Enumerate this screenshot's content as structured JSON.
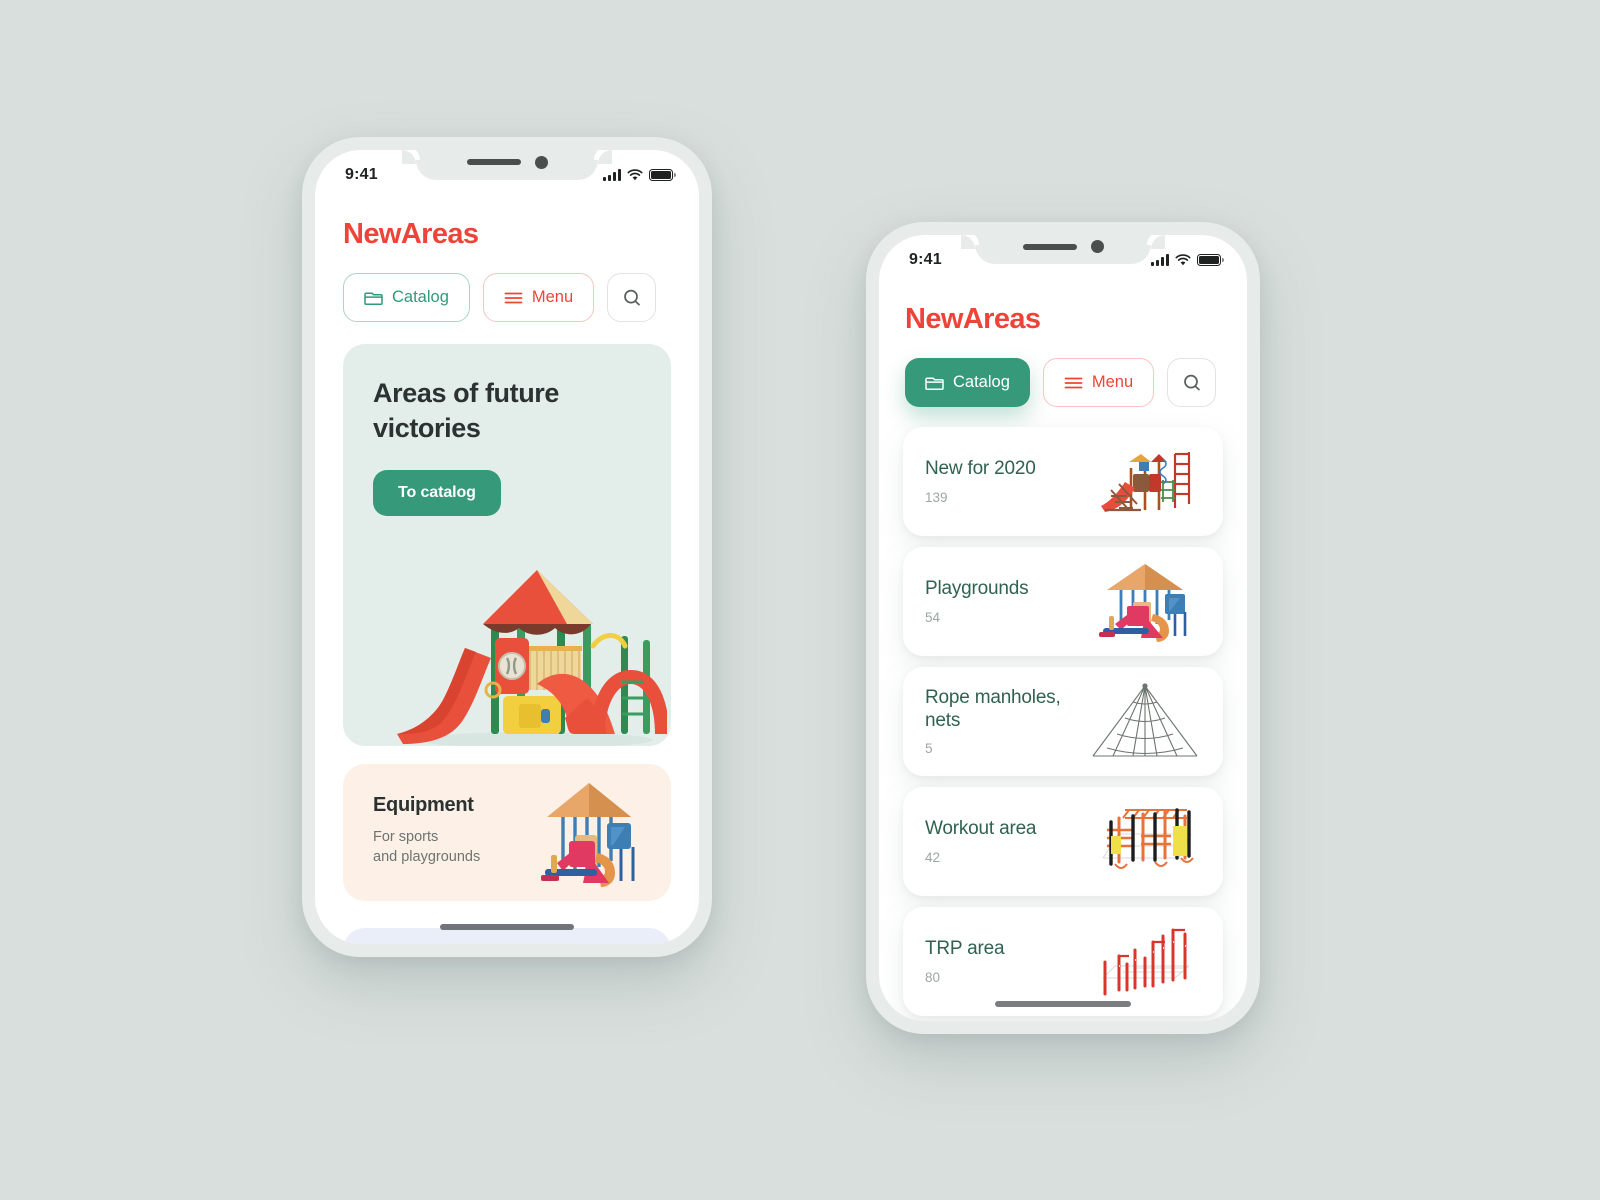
{
  "background_color": "#d9dfdd",
  "theme": {
    "brand_red": "#ee4438",
    "brand_green": "#35997a",
    "hero_card_bg": "#e3eeea",
    "equipment_card_bg": "#fdf0e6",
    "lavender_card_bg": "#eaeef8",
    "list_title_color": "#30624f",
    "phone_frame": "#e7ebea"
  },
  "phone_one": {
    "status_bar": {
      "time": "9:41",
      "signal_icon": "cellular-signal-icon",
      "wifi_icon": "wifi-icon",
      "battery_icon": "battery-full-icon"
    },
    "logo": "NewAreas",
    "toolbar": {
      "catalog_label": "Catalog",
      "catalog_icon": "folder-icon",
      "menu_label": "Menu",
      "menu_icon": "hamburger-menu-icon",
      "search_icon": "search-icon"
    },
    "hero": {
      "title": "Areas of future victories",
      "cta_label": "To catalog",
      "image": "playground-complex-red-green-illustration"
    },
    "equipment": {
      "title": "Equipment",
      "subtitle": "For sports\nand playgrounds",
      "image": "playground-equipment-blue-pink-illustration"
    },
    "next_card": {
      "visible_partial": true
    }
  },
  "phone_two": {
    "status_bar": {
      "time": "9:41",
      "signal_icon": "cellular-signal-icon",
      "wifi_icon": "wifi-icon",
      "battery_icon": "battery-full-icon"
    },
    "logo": "NewAreas",
    "toolbar": {
      "catalog_label": "Catalog",
      "catalog_icon": "folder-icon",
      "catalog_active": true,
      "menu_label": "Menu",
      "menu_icon": "hamburger-menu-icon",
      "search_icon": "search-icon"
    },
    "categories": [
      {
        "title": "New for 2020",
        "count": "139",
        "image": "playground-new-2020-illustration"
      },
      {
        "title": "Playgrounds",
        "count": "54",
        "image": "playground-structure-illustration"
      },
      {
        "title": "Rope manholes, nets",
        "count": "5",
        "image": "rope-net-pyramid-illustration"
      },
      {
        "title": "Workout area",
        "count": "42",
        "image": "workout-bars-illustration"
      },
      {
        "title": "TRP area",
        "count": "80",
        "image": "trp-bars-illustration"
      },
      {
        "title": "",
        "count": "",
        "image": ""
      }
    ]
  }
}
